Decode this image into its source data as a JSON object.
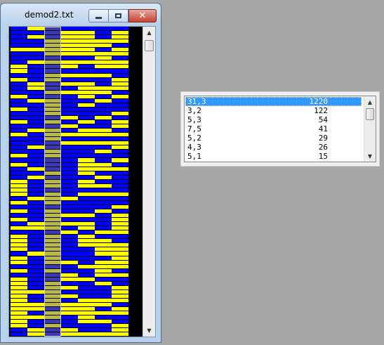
{
  "window": {
    "title": "demod2.txt",
    "minimize_icon": "minimize-icon",
    "maximize_icon": "maximize-icon",
    "close_icon": "close-icon",
    "close_glyph": "✕"
  },
  "bitgrid": {
    "colors": {
      "bit0": "#0000ff",
      "bit1": "#ffff00",
      "selected_bit0": "#3a3ab7",
      "selected_bit1": "#b9b84a",
      "background": "#000000"
    },
    "selected_column": 2,
    "columns": [
      "0000010001101000100100100100001010001111010101010111101101011111111111100",
      "1010010010000110010000001000100001010000100000110000010000000010011010011",
      "0001111010011001011110101110011000101101110111110111111101001111110110100",
      "0111111011010101000001010101000000000000100010101000000100110101011100011",
      "0111111010010111101000101101000111101101000010110111000010010000111111001",
      "0001101111010011010001001101010011010101000100001011110111101000110101001",
      "0111011011001110100010110101100101000001001011111001111110100111101100111"
    ]
  },
  "listbox": {
    "selected_index": 0,
    "rows": [
      {
        "key": "31,3",
        "count": "1220"
      },
      {
        "key": "3,2",
        "count": "122"
      },
      {
        "key": "5,3",
        "count": "54"
      },
      {
        "key": "7,5",
        "count": "41"
      },
      {
        "key": "5,2",
        "count": "29"
      },
      {
        "key": "4,3",
        "count": "26"
      },
      {
        "key": "5,1",
        "count": "15"
      }
    ]
  },
  "scroll": {
    "up_glyph": "▲",
    "down_glyph": "▼"
  }
}
